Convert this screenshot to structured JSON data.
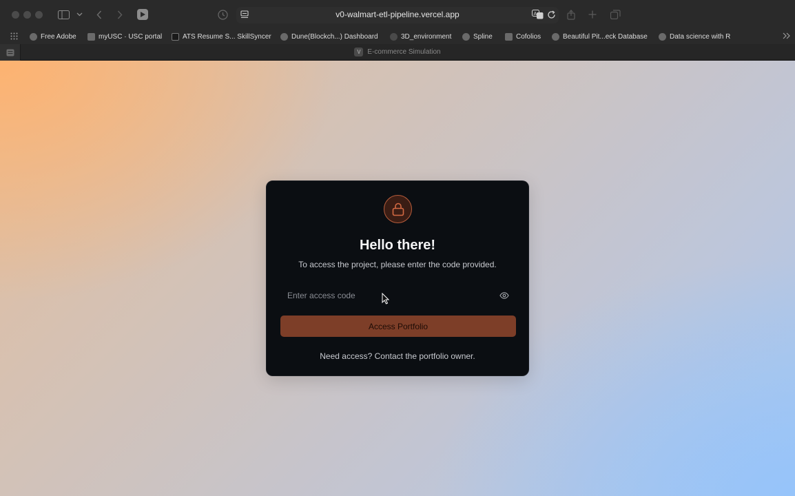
{
  "browser": {
    "url": "v0-walmart-etl-pipeline.vercel.app",
    "tab_title": "E-commerce Simulation",
    "tab_favicon": "V",
    "bookmarks": [
      {
        "label": "Free Adobe"
      },
      {
        "label": "myUSC · USC portal"
      },
      {
        "label": "ATS Resume S... SkillSyncer"
      },
      {
        "label": "Dune(Blockch...) Dashboard"
      },
      {
        "label": "3D_environment"
      },
      {
        "label": "Spline"
      },
      {
        "label": "Cofolios"
      },
      {
        "label": "Beautiful Pit...eck Database"
      },
      {
        "label": "Data science with R"
      }
    ]
  },
  "login": {
    "title": "Hello there!",
    "subtitle": "To access the project, please enter the code provided.",
    "input_placeholder": "Enter access code",
    "button_label": "Access Portfolio",
    "footer": "Need access? Contact the portfolio owner."
  },
  "colors": {
    "accent": "#b85d3c",
    "button_bg": "#7d3e28",
    "card_bg": "#0b0e12"
  }
}
